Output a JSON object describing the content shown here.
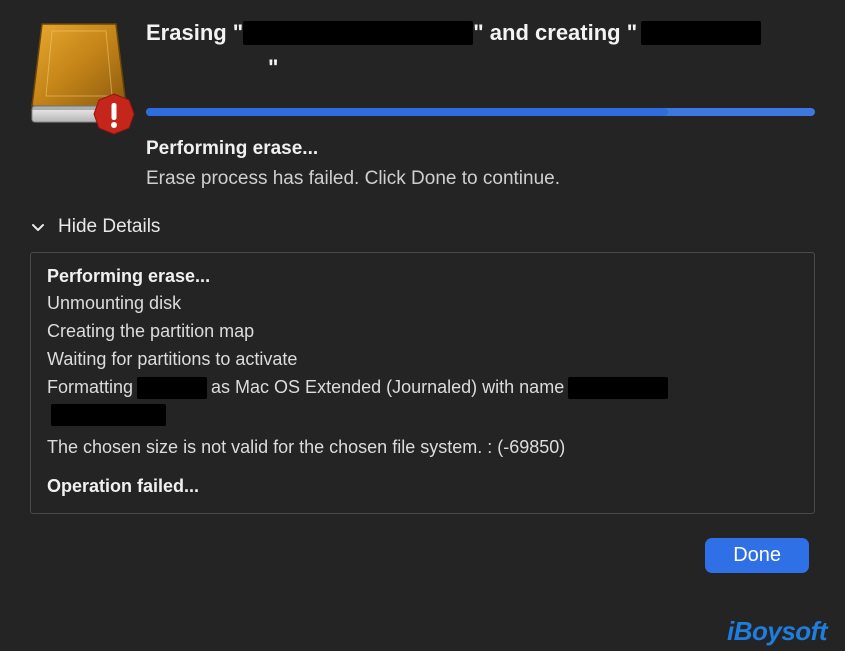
{
  "header": {
    "title_prefix": "Erasing \"",
    "title_mid": "\" and creating \"",
    "title_suffix": "\""
  },
  "status": {
    "heading": "Performing erase...",
    "subtext": "Erase process has failed. Click Done to continue."
  },
  "details_toggle_label": "Hide Details",
  "details": {
    "line_bold": "Performing erase...",
    "line1": "Unmounting disk",
    "line2": "Creating the partition map",
    "line3": "Waiting for partitions to activate",
    "fmt_prefix": "Formatting",
    "fmt_mid": "as Mac OS Extended (Journaled) with name",
    "error": "The chosen size is not valid for the chosen file system. : (-69850)",
    "opfail": "Operation failed..."
  },
  "buttons": {
    "done": "Done"
  },
  "watermark": "iBoysoft",
  "colors": {
    "accent": "#2f70e6",
    "bg": "#242424"
  }
}
